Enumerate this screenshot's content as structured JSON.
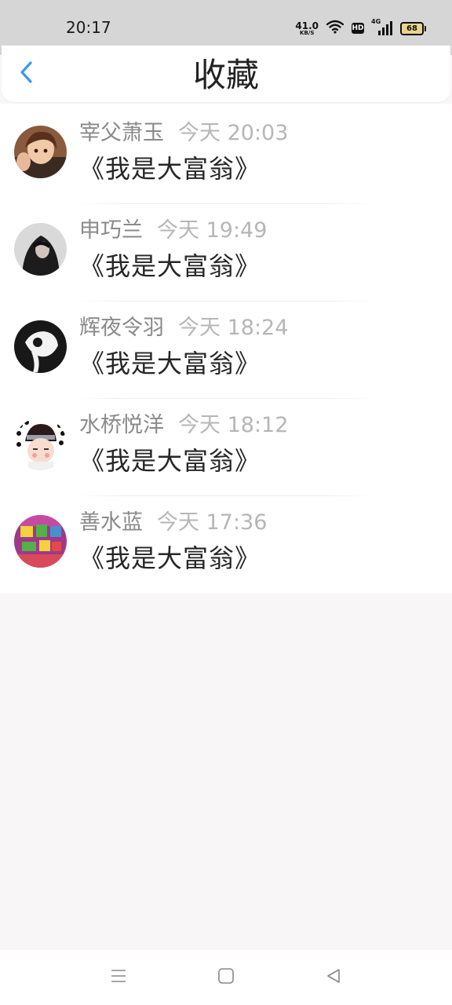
{
  "status_bar": {
    "time": "20:17",
    "net_speed_value": "41.0",
    "net_speed_unit": "KB/S",
    "hd_label": "HD",
    "cell_label": "4G",
    "battery_level": "68",
    "icons": [
      "wifi-icon",
      "hd-icon",
      "cellular-signal-icon",
      "battery-icon"
    ]
  },
  "header": {
    "back_icon": "chevron-left-icon",
    "title": "收藏",
    "accent_color": "#3a9af0"
  },
  "favorites": [
    {
      "username": "宰父萧玉",
      "time": "今天 20:03",
      "title": "《我是大富翁》"
    },
    {
      "username": "申巧兰",
      "time": "今天 19:49",
      "title": "《我是大富翁》"
    },
    {
      "username": "辉夜令羽",
      "time": "今天 18:24",
      "title": "《我是大富翁》"
    },
    {
      "username": "水桥悦洋",
      "time": "今天 18:12",
      "title": "《我是大富翁》"
    },
    {
      "username": "善水蓝",
      "time": "今天 17:36",
      "title": "《我是大富翁》"
    }
  ],
  "nav_bar": {
    "icons": [
      "menu-icon",
      "home-icon",
      "back-triangle-icon"
    ]
  }
}
